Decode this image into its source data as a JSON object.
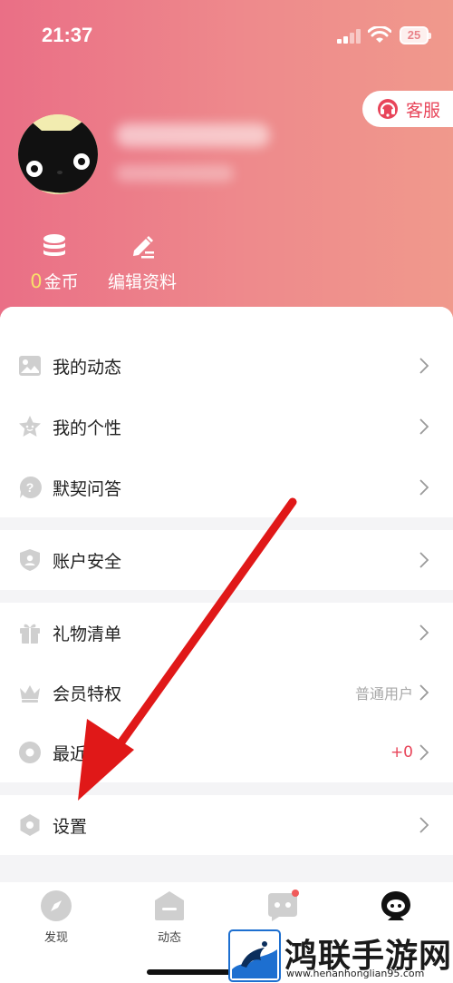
{
  "status_bar": {
    "time": "21:37",
    "battery": "25"
  },
  "header": {
    "service_label": "客服",
    "coins": {
      "count": "0",
      "label": "金币"
    },
    "edit_profile_label": "编辑资料"
  },
  "menu": {
    "sections": [
      {
        "items": [
          {
            "label": "我的动态",
            "icon": "image-icon"
          },
          {
            "label": "我的个性",
            "icon": "star-face-icon"
          },
          {
            "label": "默契问答",
            "icon": "question-icon"
          }
        ]
      },
      {
        "items": [
          {
            "label": "账户安全",
            "icon": "shield-user-icon"
          }
        ]
      },
      {
        "items": [
          {
            "label": "礼物清单",
            "icon": "gift-icon"
          },
          {
            "label": "会员特权",
            "icon": "crown-icon",
            "value": "普通用户"
          },
          {
            "label": "最近",
            "icon": "disc-icon",
            "value": "+0"
          }
        ]
      },
      {
        "items": [
          {
            "label": "设置",
            "icon": "hexagon-gear-icon"
          }
        ]
      }
    ]
  },
  "tabs": [
    {
      "label": "发现",
      "icon": "compass-icon"
    },
    {
      "label": "动态",
      "icon": "feed-icon"
    },
    {
      "label": "",
      "icon": "chat-bot-icon"
    },
    {
      "label": "",
      "icon": "profile-icon"
    }
  ],
  "watermark": {
    "title": "鸿联手游网",
    "url": "www.henanhonglian95.com"
  },
  "colors": {
    "header_start": "#ea6f86",
    "header_end": "#f0998c",
    "accent_red": "#e8455a",
    "coin_yellow": "#f8e06a",
    "annotation_arrow": "#e01818"
  }
}
